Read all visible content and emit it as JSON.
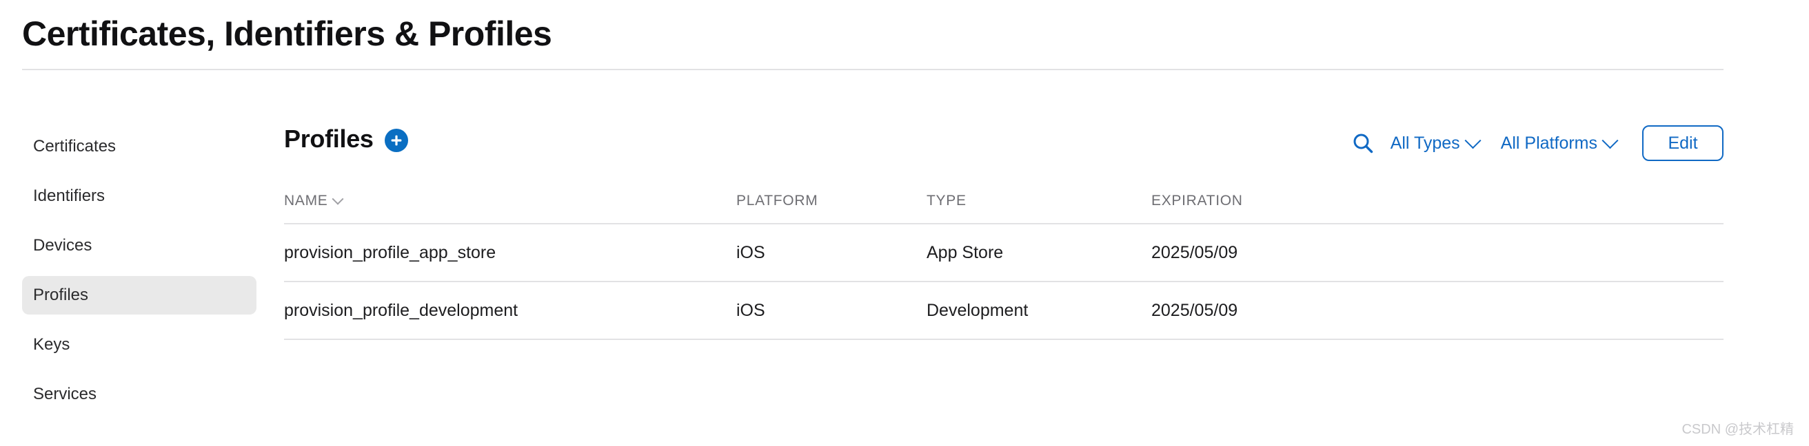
{
  "header": {
    "title": "Certificates, Identifiers & Profiles"
  },
  "sidebar": {
    "items": [
      {
        "label": "Certificates",
        "active": false
      },
      {
        "label": "Identifiers",
        "active": false
      },
      {
        "label": "Devices",
        "active": false
      },
      {
        "label": "Profiles",
        "active": true
      },
      {
        "label": "Keys",
        "active": false
      },
      {
        "label": "Services",
        "active": false
      }
    ]
  },
  "content": {
    "heading": "Profiles",
    "add_button_label": "+",
    "toolbar": {
      "search_icon": "search-icon",
      "type_filter": "All Types",
      "platform_filter": "All Platforms",
      "edit_label": "Edit"
    },
    "table": {
      "columns": [
        "NAME",
        "PLATFORM",
        "TYPE",
        "EXPIRATION"
      ],
      "sorted_column": "NAME",
      "rows": [
        {
          "name": "provision_profile_app_store",
          "platform": "iOS",
          "type": "App Store",
          "expiration": "2025/05/09"
        },
        {
          "name": "provision_profile_development",
          "platform": "iOS",
          "type": "Development",
          "expiration": "2025/05/09"
        }
      ]
    }
  },
  "watermark": "CSDN @技术杠精",
  "colors": {
    "accent_blue": "#1069c4",
    "add_button_blue": "#0a6ec2",
    "active_nav_bg": "#e9e9e9",
    "divider": "#e2e2e4",
    "muted_text": "#6e6e73"
  }
}
